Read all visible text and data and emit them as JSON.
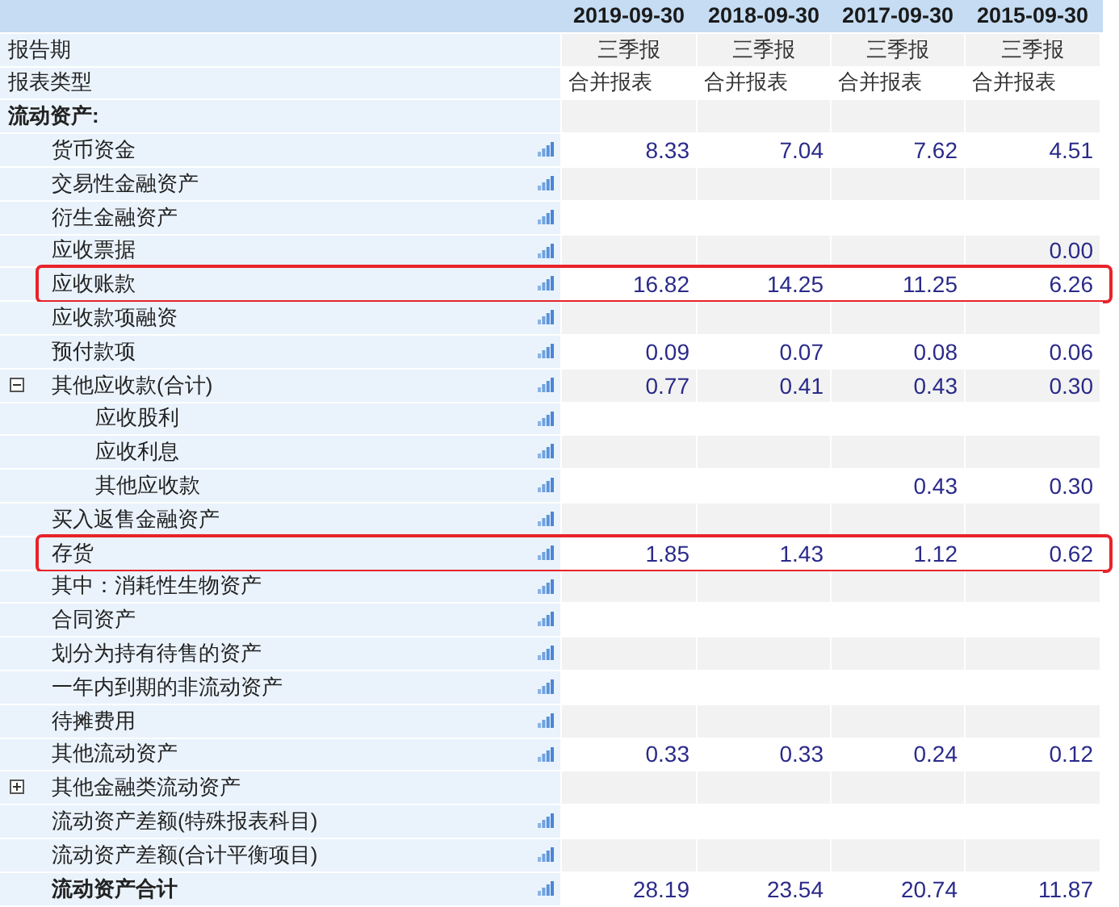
{
  "columns": [
    "2019-09-30",
    "2018-09-30",
    "2017-09-30",
    "2015-09-30"
  ],
  "rows": [
    {
      "kind": "info",
      "label": "报告期",
      "values": [
        "三季报",
        "三季报",
        "三季报",
        "三季报"
      ]
    },
    {
      "kind": "info_left",
      "label": "报表类型",
      "values": [
        "合并报表",
        "合并报表",
        "合并报表",
        "合并报表"
      ]
    },
    {
      "kind": "section",
      "label": "流动资产:"
    },
    {
      "kind": "item",
      "label": "货币资金",
      "values": [
        "8.33",
        "7.04",
        "7.62",
        "4.51"
      ],
      "chart": true,
      "highlighted": false
    },
    {
      "kind": "item",
      "label": "交易性金融资产",
      "chart": true,
      "highlighted": false
    },
    {
      "kind": "item",
      "label": "衍生金融资产",
      "chart": true,
      "highlighted": false
    },
    {
      "kind": "item",
      "label": "应收票据",
      "values": [
        "0.00"
      ],
      "chart": true,
      "highlighted": false
    },
    {
      "kind": "item",
      "label": "应收账款",
      "values": [
        "16.82",
        "14.25",
        "11.25",
        "6.26"
      ],
      "chart": true,
      "highlighted": true
    },
    {
      "kind": "item",
      "label": "应收款项融资",
      "chart": true,
      "highlighted": false
    },
    {
      "kind": "item",
      "label": "预付款项",
      "values": [
        "0.09",
        "0.07",
        "0.08",
        "0.06"
      ],
      "chart": true,
      "highlighted": false
    },
    {
      "kind": "item",
      "label": "其他应收款(合计)",
      "values": [
        "0.77",
        "0.41",
        "0.43",
        "0.30"
      ],
      "chart": true,
      "highlighted": false,
      "expanded": true,
      "children": [
        {
          "kind": "item",
          "label": "应收股利",
          "chart": true,
          "highlighted": false
        },
        {
          "kind": "item",
          "label": "应收利息",
          "chart": true,
          "highlighted": false
        },
        {
          "kind": "item",
          "label": "其他应收款",
          "values": [
            "0.43",
            "0.30"
          ],
          "chart": true,
          "highlighted": false
        }
      ]
    },
    {
      "kind": "item",
      "label": "买入返售金融资产",
      "chart": true,
      "highlighted": false
    },
    {
      "kind": "item",
      "label": "存货",
      "values": [
        "1.85",
        "1.43",
        "1.12",
        "0.62"
      ],
      "chart": true,
      "highlighted": true
    },
    {
      "kind": "item",
      "label": "其中：消耗性生物资产",
      "chart": true,
      "highlighted": false
    },
    {
      "kind": "item",
      "label": "合同资产",
      "chart": true,
      "highlighted": false
    },
    {
      "kind": "item",
      "label": "划分为持有待售的资产",
      "chart": true,
      "highlighted": false
    },
    {
      "kind": "item",
      "label": "一年内到期的非流动资产",
      "chart": true,
      "highlighted": false
    },
    {
      "kind": "item",
      "label": "待摊费用",
      "chart": true,
      "highlighted": false
    },
    {
      "kind": "item",
      "label": "其他流动资产",
      "values": [
        "0.33",
        "0.33",
        "0.24",
        "0.12"
      ],
      "chart": true,
      "highlighted": false
    },
    {
      "kind": "item",
      "label": "其他金融类流动资产",
      "chart": false,
      "highlighted": false,
      "expanded": false
    },
    {
      "kind": "item",
      "label": "流动资产差额(特殊报表科目)",
      "chart": true,
      "highlighted": false
    },
    {
      "kind": "item",
      "label": "流动资产差额(合计平衡项目)",
      "chart": true,
      "highlighted": false
    },
    {
      "kind": "total",
      "label": "流动资产合计",
      "values": [
        "28.19",
        "23.54",
        "20.74",
        "11.87"
      ],
      "chart": true,
      "highlighted": false
    }
  ]
}
